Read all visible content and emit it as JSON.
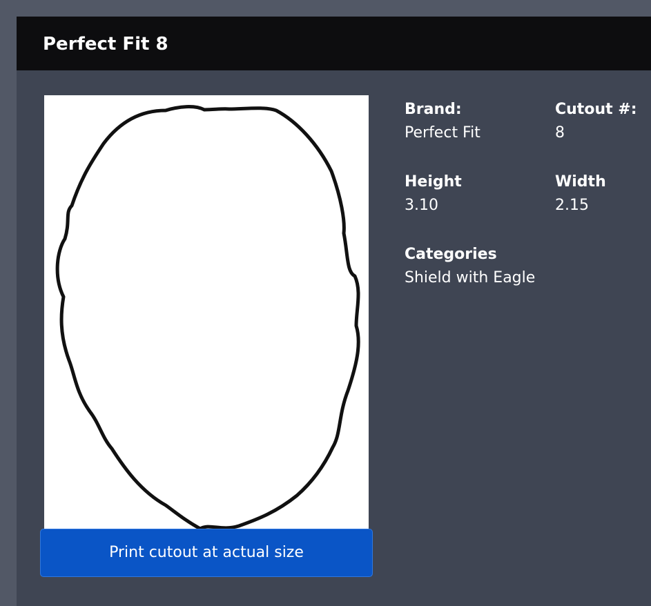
{
  "header": {
    "title": "Perfect Fit 8"
  },
  "preview": {
    "shape_icon": "oval-cutout-outline",
    "print_button_label": "Print cutout at actual size"
  },
  "details": {
    "brand": {
      "label": "Brand:",
      "value": "Perfect Fit"
    },
    "cutout": {
      "label": "Cutout #:",
      "value": "8"
    },
    "height": {
      "label": "Height",
      "value": "3.10"
    },
    "width": {
      "label": "Width",
      "value": "2.15"
    },
    "categories": {
      "label": "Categories",
      "value": "Shield with Eagle"
    }
  },
  "colors": {
    "page_background": "#525866",
    "panel_background": "#3f4553",
    "header_background": "#0d0d0f",
    "button_background": "#0a55c6",
    "text": "#ffffff"
  }
}
